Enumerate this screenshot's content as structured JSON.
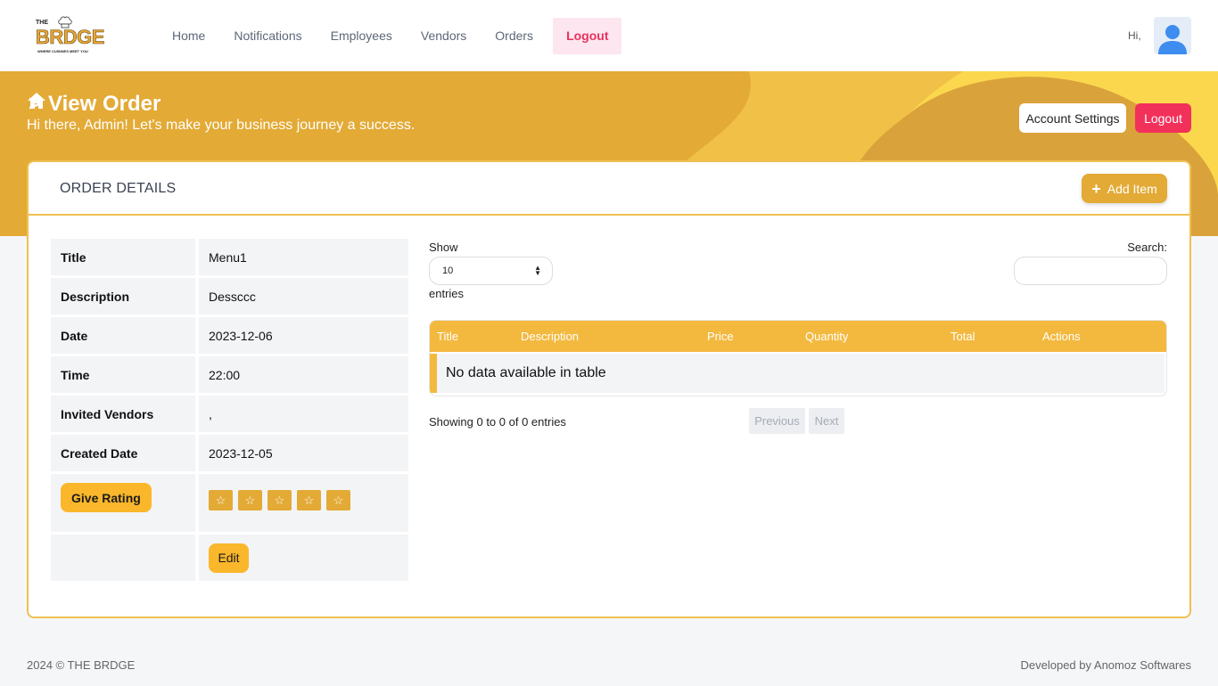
{
  "brand": {
    "the": "THE",
    "name": "BRDGE",
    "tagline": "WHERE CUISINES MEET YOU"
  },
  "nav": {
    "items": [
      {
        "label": "Home"
      },
      {
        "label": "Notifications"
      },
      {
        "label": "Employees"
      },
      {
        "label": "Vendors"
      },
      {
        "label": "Orders"
      }
    ],
    "logout_label": "Logout",
    "greeting": "Hi,"
  },
  "banner": {
    "page_title": "View Order",
    "separator": ">",
    "welcome": "Hi there, Admin! Let's make your business journey a success.",
    "account_settings_label": "Account Settings",
    "logout_label": "Logout"
  },
  "card": {
    "title": "ORDER DETAILS",
    "add_item_label": "Add Item"
  },
  "details": {
    "rows": [
      {
        "label": "Title",
        "value": "Menu1"
      },
      {
        "label": "Description",
        "value": "Dessccc"
      },
      {
        "label": "Date",
        "value": "2023-12-06"
      },
      {
        "label": "Time",
        "value": "22:00"
      },
      {
        "label": "Invited Vendors",
        "value": ","
      },
      {
        "label": "Created Date",
        "value": "2023-12-05"
      }
    ],
    "give_rating_label": "Give Rating",
    "rating": 0,
    "rating_max": 5,
    "edit_label": "Edit"
  },
  "datatable": {
    "show_label": "Show",
    "page_size": "10",
    "entries_label": "entries",
    "search_label": "Search:",
    "search_value": "",
    "columns": [
      "Title",
      "Description",
      "Price",
      "Quantity",
      "Total",
      "Actions"
    ],
    "empty_message": "No data available in table",
    "info": "Showing 0 to 0 of 0 entries",
    "previous_label": "Previous",
    "next_label": "Next"
  },
  "footer": {
    "copyright": "2024  © THE BRDGE",
    "developer": "Developed by Anomoz Softwares"
  },
  "colors": {
    "accent": "#e3aa36",
    "accent_light": "#fbb72b",
    "logout": "#f2315b"
  }
}
